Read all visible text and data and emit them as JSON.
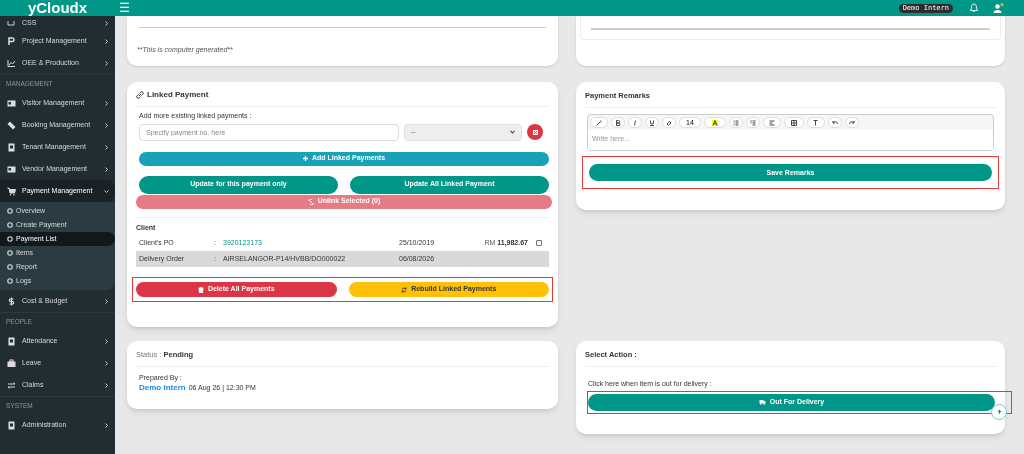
{
  "header": {
    "logo": "yCloudx",
    "menu_glyph": "☰",
    "user": "Demo Intern"
  },
  "sidebar": [
    {
      "kind": "item",
      "label": "CSS",
      "expanded": false,
      "selected": false
    },
    {
      "kind": "item",
      "label": "Project Management",
      "expanded": false,
      "selected": false
    },
    {
      "kind": "item",
      "label": "OEE & Production",
      "expanded": false,
      "selected": false
    },
    {
      "kind": "section",
      "label": "MANAGEMENT"
    },
    {
      "kind": "item",
      "label": "Visitor Management",
      "expanded": false,
      "selected": false
    },
    {
      "kind": "item",
      "label": "Booking Management",
      "expanded": false,
      "selected": false
    },
    {
      "kind": "item",
      "label": "Tenant Management",
      "expanded": false,
      "selected": false
    },
    {
      "kind": "item",
      "label": "Vendor Management",
      "expanded": false,
      "selected": false
    },
    {
      "kind": "item",
      "label": "Payment Management",
      "expanded": true,
      "selected": true,
      "children": [
        {
          "label": "Overview",
          "selected": false
        },
        {
          "label": "Create Payment",
          "selected": false
        },
        {
          "label": "Payment List",
          "selected": true
        },
        {
          "label": "Items",
          "selected": false
        },
        {
          "label": "Report",
          "selected": false
        },
        {
          "label": "Logs",
          "selected": false
        }
      ]
    },
    {
      "kind": "item",
      "label": "Cost & Budget",
      "expanded": false,
      "selected": false
    },
    {
      "kind": "section",
      "label": "PEOPLE"
    },
    {
      "kind": "item",
      "label": "Attendance",
      "expanded": false,
      "selected": false
    },
    {
      "kind": "item",
      "label": "Leave",
      "expanded": false,
      "selected": false
    },
    {
      "kind": "item",
      "label": "Claims",
      "expanded": false,
      "selected": false
    },
    {
      "kind": "section",
      "label": "SYSTEM"
    },
    {
      "kind": "item",
      "label": "Administration",
      "expanded": false,
      "selected": false
    }
  ],
  "top_left_card": {
    "note": "**This is computer generated**"
  },
  "linked_payment": {
    "title": "Linked Payment",
    "add_label": "Add more existing linked payments :",
    "placeholder": "Specify payment no. here",
    "select_value": "--",
    "add_button": "Add Linked Payments",
    "update_buttons": [
      "Update for this payment only",
      "Update All Linked Payment"
    ],
    "unlink_button": "Unlink Selected (0)",
    "client_heading": "Client",
    "rows": [
      {
        "label": "Client's PO",
        "separator": ":",
        "value": "3920123173",
        "link": true,
        "date": "25/10/2019",
        "currency": "RM",
        "amount": "11,982.67",
        "checked": false,
        "shaded": false
      },
      {
        "label": "Delivery Order",
        "separator": ":",
        "value": "AIRSELANGOR-P14/HVBB/DO000022",
        "link": false,
        "date": "06/08/2026",
        "shaded": true
      }
    ],
    "actions": [
      {
        "kind": "danger",
        "label": "Delete All Payments"
      },
      {
        "kind": "warning",
        "label": "Rebuild Linked Payments"
      }
    ],
    "actions_highlighted": true
  },
  "remarks": {
    "title": "Payment Remarks",
    "font_size": "14",
    "placeholder": "Write here...",
    "save_button": "Save Remarks",
    "save_highlighted": true
  },
  "status": {
    "label": "Status :",
    "value": "Pending",
    "prepared_label": "Prepared By :",
    "name": "Demo Intern",
    "time": "06 Aug 26 | 12:30 PM"
  },
  "select_action": {
    "title": "Select Action :",
    "hint": "Click here when item is out for delivery :",
    "button": "Out For Delivery",
    "highlighted": true
  }
}
